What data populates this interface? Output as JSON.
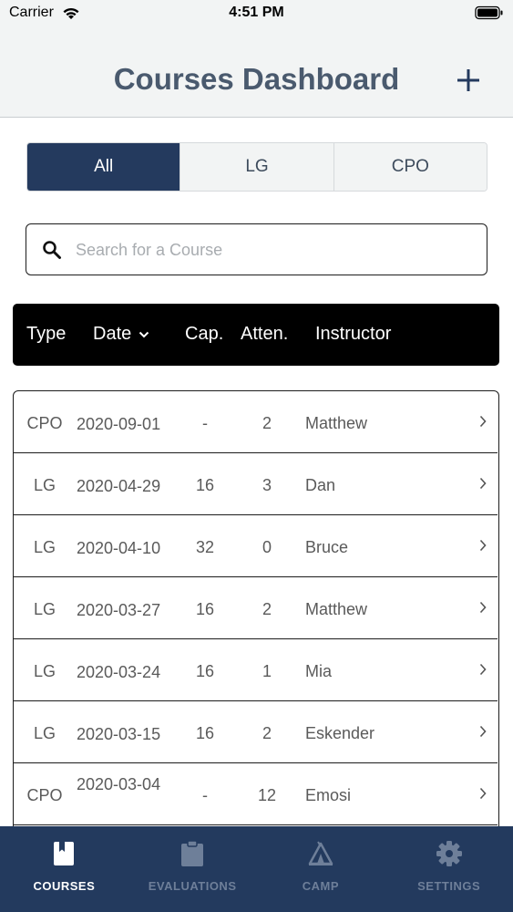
{
  "status_bar": {
    "carrier": "Carrier",
    "time": "4:51 PM"
  },
  "header": {
    "title": "Courses Dashboard",
    "add_icon": "plus-icon"
  },
  "filter": {
    "segments": [
      "All",
      "LG",
      "CPO"
    ],
    "selected": "All"
  },
  "search": {
    "placeholder": "Search for a Course",
    "value": "",
    "icon": "search-icon"
  },
  "table": {
    "columns": {
      "type": "Type",
      "date": "Date",
      "cap": "Cap.",
      "atten": "Atten.",
      "instructor": "Instructor"
    },
    "sort_icon": "chevron-down-icon",
    "rows": [
      {
        "type": "CPO",
        "date": "2020-09-01",
        "cap": "-",
        "atten": "2",
        "instructor": "Matthew"
      },
      {
        "type": "LG",
        "date": "2020-04-29",
        "cap": "16",
        "atten": "3",
        "instructor": "Dan"
      },
      {
        "type": "LG",
        "date": "2020-04-10",
        "cap": "32",
        "atten": "0",
        "instructor": "Bruce"
      },
      {
        "type": "LG",
        "date": "2020-03-27",
        "cap": "16",
        "atten": "2",
        "instructor": "Matthew"
      },
      {
        "type": "LG",
        "date": "2020-03-24",
        "cap": "16",
        "atten": "1",
        "instructor": "Mia"
      },
      {
        "type": "LG",
        "date": "2020-03-15",
        "cap": "16",
        "atten": "2",
        "instructor": "Eskender"
      },
      {
        "type": "CPO",
        "date": "2020-03-04",
        "cap": "-",
        "atten": "12",
        "instructor": "Emosi"
      }
    ]
  },
  "tab_bar": {
    "tabs": [
      {
        "label": "COURSES",
        "icon": "book-icon",
        "active": true
      },
      {
        "label": "EVALUATIONS",
        "icon": "clipboard-icon",
        "active": false
      },
      {
        "label": "CAMP",
        "icon": "tent-icon",
        "active": false
      },
      {
        "label": "SETTINGS",
        "icon": "gear-icon",
        "active": false
      }
    ]
  },
  "colors": {
    "primary": "#243a5e",
    "header_bg": "#f2f4f4",
    "title": "#4a5a6e",
    "tab_inactive": "#6e7f99"
  }
}
